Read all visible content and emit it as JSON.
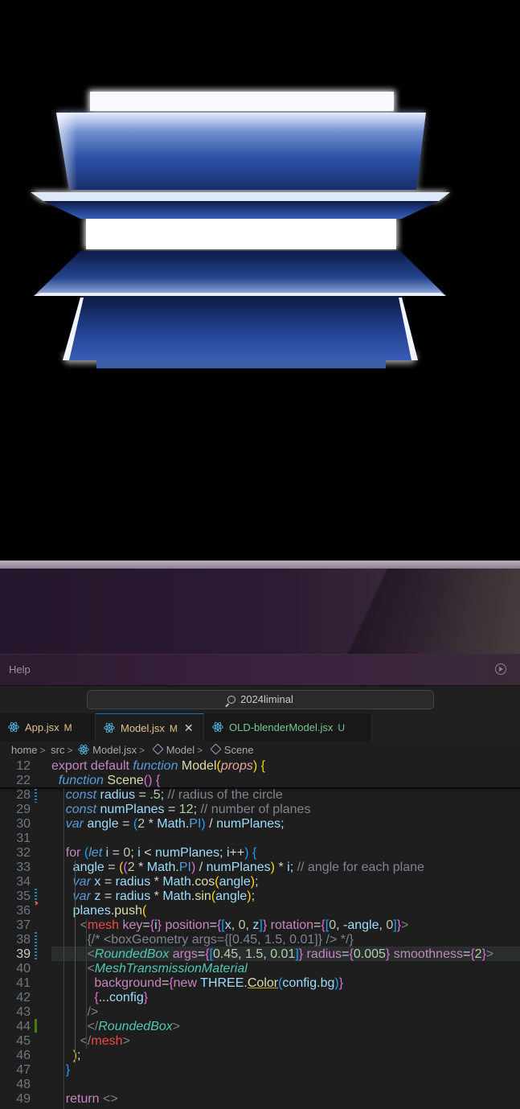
{
  "help_panel": {
    "label": "Help"
  },
  "command_center": {
    "text": "2024liminal"
  },
  "tabs": [
    {
      "label": "App.jsx",
      "badge": "M",
      "active": false
    },
    {
      "label": "Model.jsx",
      "badge": "M",
      "active": true
    },
    {
      "label": "OLD-blenderModel.jsx",
      "badge": "U",
      "active": false
    }
  ],
  "breadcrumb": [
    "home",
    "src",
    "Model.jsx",
    "Model",
    "Scene"
  ],
  "editor": {
    "current_line": "39",
    "lines": [
      {
        "n": "12",
        "text": "export default function Model(props) {"
      },
      {
        "n": "22",
        "text": "  function Scene() {"
      },
      {
        "n": "28",
        "text": "    const radius = .5; // radius of the circle"
      },
      {
        "n": "29",
        "text": "    const numPlanes = 12; // number of planes"
      },
      {
        "n": "30",
        "text": "    var angle = (2 * Math.PI) / numPlanes;"
      },
      {
        "n": "31",
        "text": ""
      },
      {
        "n": "32",
        "text": "    for (let i = 0; i < numPlanes; i++) {"
      },
      {
        "n": "33",
        "text": "      angle = ((2 * Math.PI) / numPlanes) * i; // angle for each plane"
      },
      {
        "n": "34",
        "text": "      var x = radius * Math.cos(angle);"
      },
      {
        "n": "35",
        "text": "      var z = radius * Math.sin(angle);"
      },
      {
        "n": "36",
        "text": "      planes.push("
      },
      {
        "n": "37",
        "text": "        <mesh key={i} position={[x, 0, z]} rotation={[0, -angle, 0]}>"
      },
      {
        "n": "38",
        "text": "          {/* <boxGeometry args={[0.45, 1.5, 0.01]} /> */}"
      },
      {
        "n": "39",
        "text": "          <RoundedBox args={[0.45, 1.5, 0.01]} radius={0.005} smoothness={2}>"
      },
      {
        "n": "40",
        "text": "          <MeshTransmissionMaterial"
      },
      {
        "n": "41",
        "text": "            background={new THREE.Color(config.bg)}"
      },
      {
        "n": "42",
        "text": "            {...config}"
      },
      {
        "n": "43",
        "text": "          />"
      },
      {
        "n": "44",
        "text": "          </RoundedBox>"
      },
      {
        "n": "45",
        "text": "        </mesh>"
      },
      {
        "n": "46",
        "text": "      );"
      },
      {
        "n": "47",
        "text": "    }"
      },
      {
        "n": "48",
        "text": ""
      },
      {
        "n": "49",
        "text": "    return <>"
      }
    ]
  }
}
